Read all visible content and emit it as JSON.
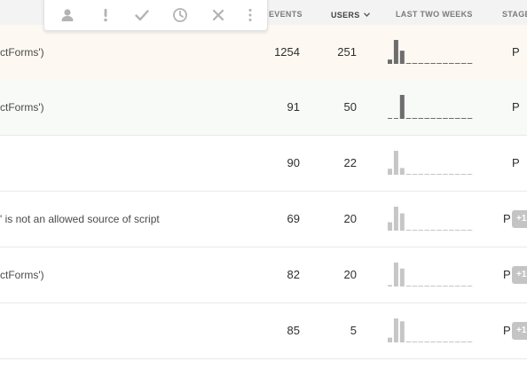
{
  "columns": {
    "events": "EVENTS",
    "users": "USERS",
    "last_two_weeks": "LAST TWO WEEKS",
    "stage": "STAGE"
  },
  "toolbar": {
    "icons": [
      "assign-user-icon",
      "priority-icon",
      "resolve-check-icon",
      "snooze-clock-icon",
      "ignore-x-icon",
      "more-options-icon"
    ]
  },
  "colors": {
    "spark_dark": "#6d6d6d",
    "spark_light": "#c6c6c6",
    "highlight_row": "#fdf9f2",
    "badge": "#c4c4c4"
  },
  "rows": [
    {
      "message": "ctForms')",
      "events": "1254",
      "users": "251",
      "stage": "P",
      "badge": "",
      "spark_color": "dark",
      "spark_values": [
        0.18,
        1.0,
        0.55,
        0.03,
        0.03,
        0.03,
        0.03,
        0.03,
        0.03,
        0.03,
        0.03,
        0.03,
        0.03,
        0.03
      ]
    },
    {
      "message": "ctForms')",
      "events": "91",
      "users": "50",
      "stage": "P",
      "badge": "",
      "spark_color": "dark",
      "spark_values": [
        0.03,
        0.03,
        1.0,
        0.03,
        0.03,
        0.03,
        0.03,
        0.03,
        0.03,
        0.03,
        0.03,
        0.03,
        0.03,
        0.03
      ]
    },
    {
      "message": "",
      "events": "90",
      "users": "22",
      "stage": "P",
      "badge": "",
      "spark_color": "light",
      "spark_values": [
        0.25,
        1.0,
        0.28,
        0.03,
        0.03,
        0.03,
        0.03,
        0.03,
        0.03,
        0.03,
        0.03,
        0.03,
        0.03,
        0.03
      ]
    },
    {
      "message": "' is not an allowed source of script",
      "events": "69",
      "users": "20",
      "stage": "P",
      "badge": "+1",
      "spark_color": "light",
      "spark_values": [
        0.35,
        1.0,
        0.72,
        0.03,
        0.03,
        0.03,
        0.03,
        0.03,
        0.03,
        0.03,
        0.03,
        0.03,
        0.03,
        0.03
      ]
    },
    {
      "message": "ctForms')",
      "events": "82",
      "users": "20",
      "stage": "P",
      "badge": "+1",
      "spark_color": "light",
      "spark_values": [
        0.06,
        1.0,
        0.75,
        0.03,
        0.03,
        0.03,
        0.03,
        0.03,
        0.03,
        0.03,
        0.03,
        0.03,
        0.03,
        0.03
      ]
    },
    {
      "message": "",
      "events": "85",
      "users": "5",
      "stage": "P",
      "badge": "+1",
      "spark_color": "light",
      "spark_values": [
        0.2,
        1.0,
        0.88,
        0.03,
        0.03,
        0.03,
        0.03,
        0.03,
        0.03,
        0.03,
        0.03,
        0.03,
        0.03,
        0.03
      ]
    }
  ]
}
